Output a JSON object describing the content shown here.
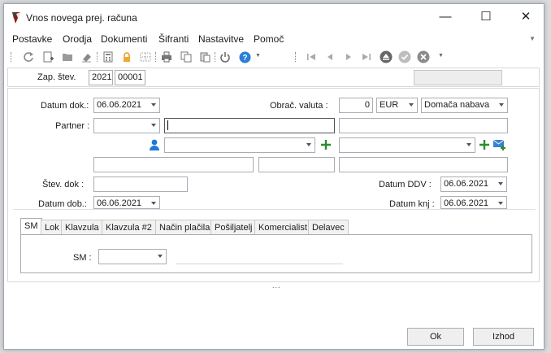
{
  "window": {
    "title": "Vnos novega prej. računa",
    "minimize": "—",
    "maximize": "☐",
    "close": "✕"
  },
  "menu": [
    {
      "label": "Postavke"
    },
    {
      "label": "Orodja"
    },
    {
      "label": "Dokumenti"
    },
    {
      "label": "Šifranti"
    },
    {
      "label": "Nastavitve"
    },
    {
      "label": "Pomoč"
    }
  ],
  "toolbar": {
    "icons": [
      "refresh-icon",
      "new-document-icon",
      "open-folder-icon",
      "eraser-icon",
      "calculator-icon",
      "lock-icon",
      "grid-icon",
      "print-icon",
      "copy-icon",
      "paste-icon",
      "power-icon",
      "help-icon",
      "first-record-icon",
      "previous-record-icon",
      "next-record-icon",
      "last-record-icon",
      "eject-icon",
      "confirm-icon",
      "cancel-icon"
    ],
    "help_glyph": "?"
  },
  "header": {
    "zap_label": "Zap. štev.",
    "year": "2021",
    "number": "00001"
  },
  "form": {
    "datum_dok_label": "Datum dok.:",
    "datum_dok_value": "06.06.2021",
    "obrac_valuta_label": "Obrač. valuta :",
    "rate_value": "0",
    "currency_value": "EUR",
    "nabava_value": "Domača nabava",
    "partner_label": "Partner :",
    "partner_code": "",
    "partner_name": "",
    "stev_dok_label": "Štev. dok :",
    "stev_dok_value": "",
    "datum_ddv_label": "Datum DDV :",
    "datum_ddv_value": "06.06.2021",
    "datum_dob_label": "Datum dob.:",
    "datum_dob_value": "06.06.2021",
    "datum_knj_label": "Datum knj :",
    "datum_knj_value": "06.06.2021"
  },
  "tabs": [
    {
      "label": "SM"
    },
    {
      "label": "Lok"
    },
    {
      "label": "Klavzula"
    },
    {
      "label": "Klavzula #2"
    },
    {
      "label": "Način plačila"
    },
    {
      "label": "Pošiljatelj"
    },
    {
      "label": "Komercialist"
    },
    {
      "label": "Delavec"
    }
  ],
  "sm": {
    "label": "SM :",
    "value": ""
  },
  "splitter": "...",
  "buttons": {
    "ok": "Ok",
    "exit": "Izhod"
  },
  "colors": {
    "accent_blue": "#1c7ad8",
    "add_green": "#2e8b2e"
  }
}
